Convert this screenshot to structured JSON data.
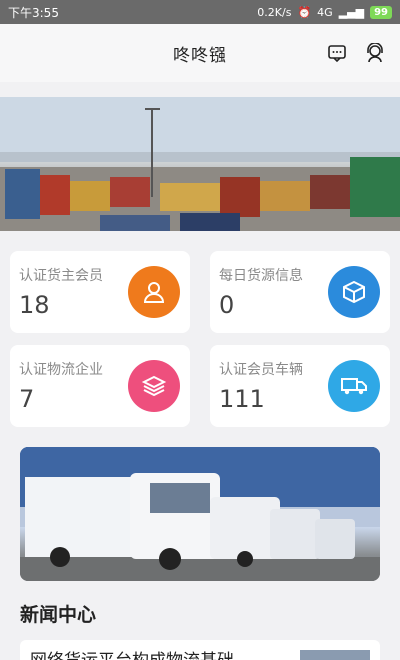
{
  "status_bar": {
    "time": "下午3:55",
    "speed": "0.2K/s",
    "network": "4G",
    "battery": "99"
  },
  "header": {
    "title": "咚咚镪"
  },
  "stats": [
    {
      "label": "认证货主会员",
      "value": "18",
      "color": "#ef7a1c"
    },
    {
      "label": "每日货源信息",
      "value": "0",
      "color": "#2b8bdc"
    },
    {
      "label": "认证物流企业",
      "value": "7",
      "color": "#ee4f7d"
    },
    {
      "label": "认证会员车辆",
      "value": "111",
      "color": "#2fa8e6"
    }
  ],
  "news": {
    "section_title": "新闻中心",
    "items": [
      {
        "title": "网络货运平台构成物流基础"
      }
    ]
  },
  "icons": {
    "message": "message-icon",
    "support": "support-icon",
    "member": "member-icon",
    "cube": "cube-icon",
    "layers": "layers-icon",
    "truck": "truck-icon"
  }
}
